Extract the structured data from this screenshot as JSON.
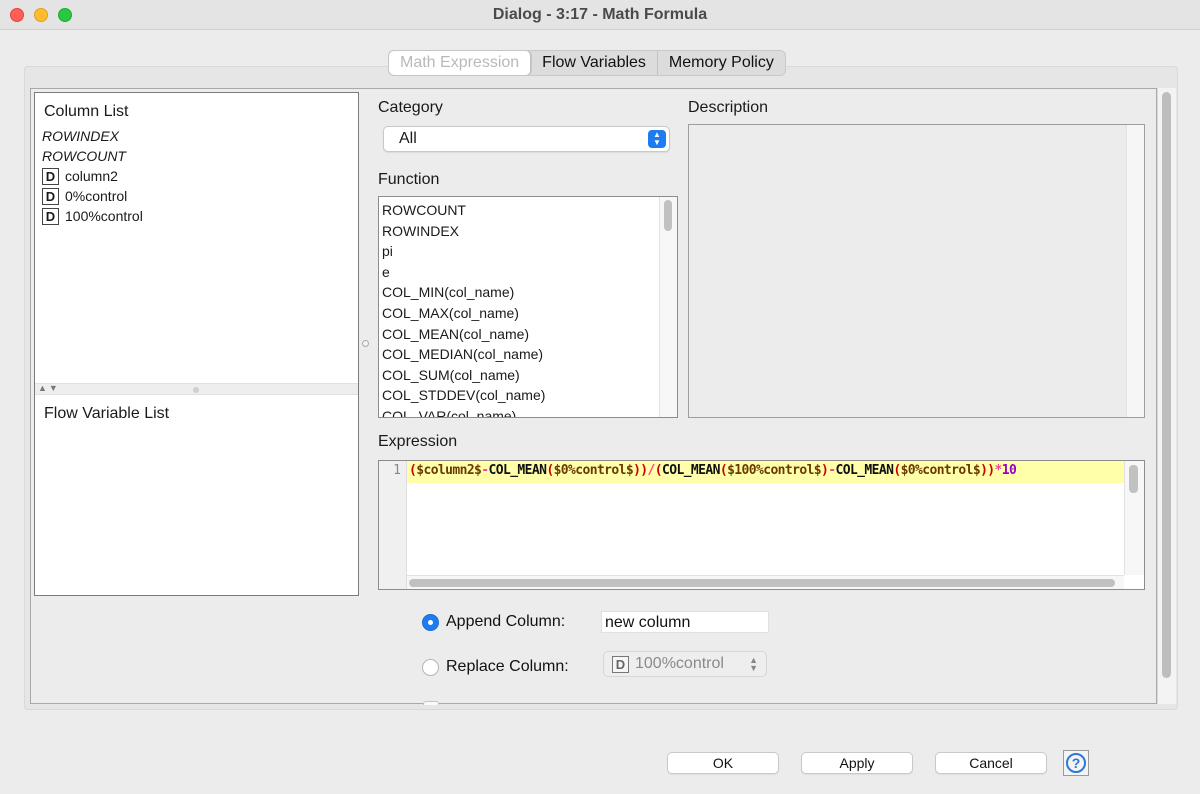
{
  "window": {
    "title": "Dialog - 3:17 - Math Formula"
  },
  "tabs": [
    {
      "label": "Math Expression",
      "active": true
    },
    {
      "label": "Flow Variables",
      "active": false
    },
    {
      "label": "Memory Policy",
      "active": false
    }
  ],
  "column_list": {
    "label": "Column List",
    "items": [
      {
        "label": "ROWINDEX",
        "italic": true
      },
      {
        "label": "ROWCOUNT",
        "italic": true
      },
      {
        "label": "column2",
        "type": "D"
      },
      {
        "label": "0%control",
        "type": "D"
      },
      {
        "label": "100%control",
        "type": "D"
      }
    ]
  },
  "flow_variable_list": {
    "label": "Flow Variable List"
  },
  "category": {
    "label": "Category",
    "selected": "All"
  },
  "function": {
    "label": "Function",
    "items": [
      "ROWCOUNT",
      "ROWINDEX",
      "pi",
      "e",
      "COL_MIN(col_name)",
      "COL_MAX(col_name)",
      "COL_MEAN(col_name)",
      "COL_MEDIAN(col_name)",
      "COL_SUM(col_name)",
      "COL_STDDEV(col_name)",
      "COL_VAR(col_name)"
    ]
  },
  "description": {
    "label": "Description"
  },
  "expression": {
    "label": "Expression",
    "line_number": "1",
    "tokens": {
      "t1": "(",
      "t2": "$column2$",
      "t3": "-",
      "t4": "COL_MEAN",
      "t5": "(",
      "t6": "$0%control$",
      "t7": "))",
      "t8": "/",
      "t9": "(",
      "t10": "COL_MEAN",
      "t11": "(",
      "t12": "$100%control$",
      "t13": ")",
      "t14": "-",
      "t15": "COL_MEAN",
      "t16": "(",
      "t17": "$0%control$",
      "t18": "))",
      "t19": "*",
      "t20": "10"
    }
  },
  "output": {
    "append_label": "Append Column:",
    "append_selected": true,
    "append_value": "new column",
    "replace_label": "Replace Column:",
    "replace_selected": false,
    "replace_value_type": "D",
    "replace_value": "100%control"
  },
  "buttons": {
    "ok": "OK",
    "apply": "Apply",
    "cancel": "Cancel",
    "help": "?"
  },
  "colors": {
    "accent": "#1e7cf2",
    "highlight": "#ffffaa"
  }
}
